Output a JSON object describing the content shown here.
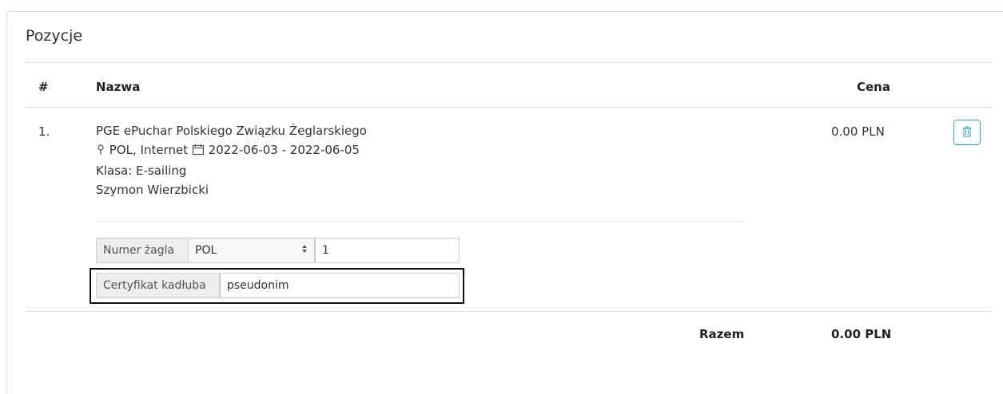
{
  "panel": {
    "title": "Pozycje"
  },
  "table": {
    "headers": {
      "index": "#",
      "name": "Nazwa",
      "price": "Cena"
    },
    "rows": [
      {
        "index": "1.",
        "event_name": "PGE ePuchar Polskiego Związku Żeglarskiego",
        "location": "POL, Internet",
        "location_icon": "map-pin-icon",
        "date_icon": "calendar-icon",
        "dates": "2022-06-03 - 2022-06-05",
        "class": "Klasa: E-sailing",
        "participant": "Szymon Wierzbicki",
        "price": "0.00 PLN",
        "delete_icon": "trash-icon",
        "sail_number": {
          "label": "Numer żagla",
          "country_value": "POL",
          "number_value": "1"
        },
        "hull_certificate": {
          "label": "Certyfikat kadłuba",
          "value": "pseudonim"
        }
      }
    ],
    "footer": {
      "total_label": "Razem",
      "total_value": "0.00 PLN"
    }
  },
  "colors": {
    "accent": "#39a4c6",
    "border": "#cccccc",
    "addon_bg": "#eeeeee"
  }
}
